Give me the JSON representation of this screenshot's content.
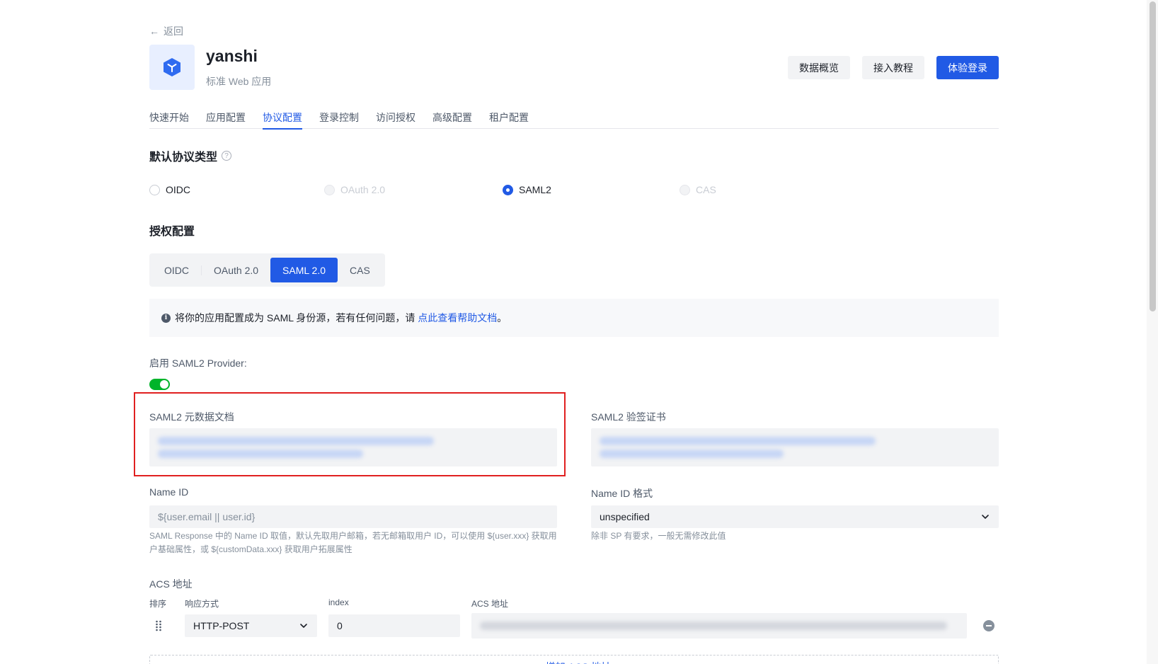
{
  "nav": {
    "back_label": "返回"
  },
  "app": {
    "name": "yanshi",
    "type": "标准 Web 应用"
  },
  "actions": {
    "overview": "数据概览",
    "tutorial": "接入教程",
    "try_login": "体验登录"
  },
  "tabs": [
    {
      "label": "快速开始"
    },
    {
      "label": "应用配置"
    },
    {
      "label": "协议配置",
      "active": true
    },
    {
      "label": "登录控制"
    },
    {
      "label": "访问授权"
    },
    {
      "label": "高级配置"
    },
    {
      "label": "租户配置"
    }
  ],
  "default_protocol": {
    "title": "默认协议类型",
    "help_icon": "?",
    "options": [
      {
        "label": "OIDC",
        "state": "unchecked"
      },
      {
        "label": "OAuth 2.0",
        "state": "disabled"
      },
      {
        "label": "SAML2",
        "state": "checked"
      },
      {
        "label": "CAS",
        "state": "disabled"
      }
    ]
  },
  "auth_config": {
    "title": "授权配置",
    "segments": [
      {
        "label": "OIDC"
      },
      {
        "label": "OAuth 2.0"
      },
      {
        "label": "SAML 2.0",
        "active": true
      },
      {
        "label": "CAS"
      }
    ]
  },
  "alert": {
    "icon": "i",
    "text": "将你的应用配置成为 SAML 身份源，若有任何问题，请",
    "link": "点此查看帮助文档",
    "suffix": "。"
  },
  "saml": {
    "enable_label": "启用 SAML2 Provider:",
    "enabled": true,
    "metadata_label": "SAML2 元数据文档",
    "cert_label": "SAML2 验签证书",
    "name_id_label": "Name ID",
    "name_id_placeholder": "${user.email || user.id}",
    "name_id_hint": "SAML Response 中的 Name ID 取值，默认先取用户邮箱，若无邮箱取用户 ID，可以使用 ${user.xxx} 获取用户基础属性，或 ${customData.xxx} 获取用户拓展属性",
    "name_id_format_label": "Name ID 格式",
    "name_id_format_value": "unspecified",
    "name_id_format_hint": "除非 SP 有要求，一般无需修改此值"
  },
  "acs": {
    "title": "ACS 地址",
    "columns": {
      "order": "排序",
      "binding": "响应方式",
      "index": "index",
      "url": "ACS 地址"
    },
    "rows": [
      {
        "binding": "HTTP-POST",
        "index": "0"
      }
    ],
    "add_label": "+ 增加 ACS 地址"
  },
  "colors": {
    "primary": "#215ae5",
    "toggle_on": "#00b42a",
    "highlight": "#e02020"
  }
}
